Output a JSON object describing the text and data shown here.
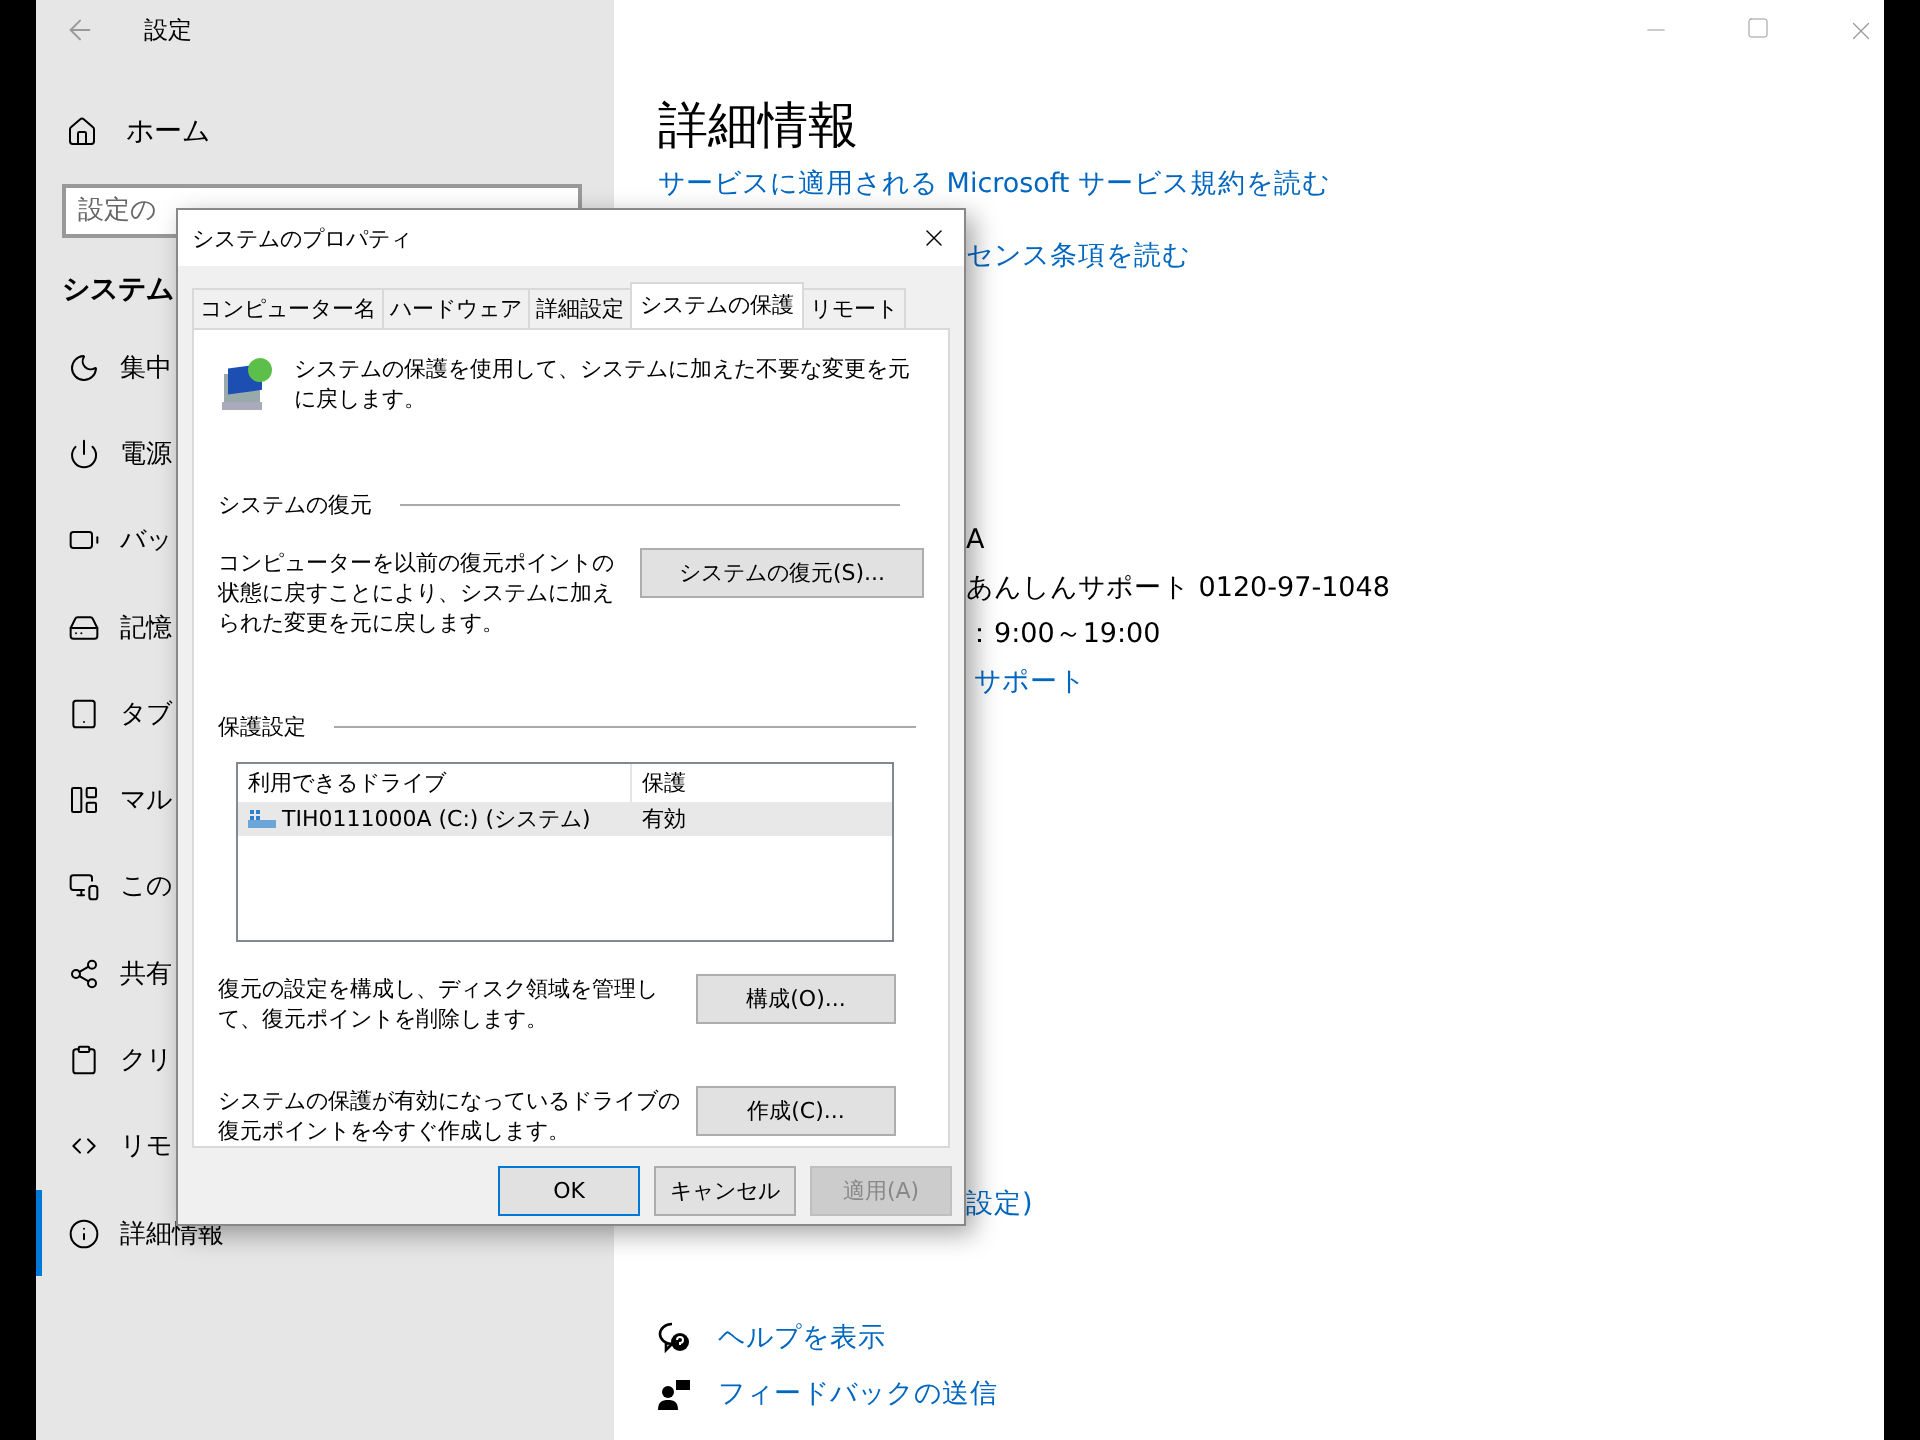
{
  "settings": {
    "title": "設定",
    "home": "ホーム",
    "search": {
      "placeholder": "設定の"
    },
    "section": "システム",
    "nav_items": [
      {
        "label": "集中",
        "selected": false
      },
      {
        "label": "電源",
        "selected": false
      },
      {
        "label": "バッ",
        "selected": false
      },
      {
        "label": "記憶",
        "selected": false
      },
      {
        "label": "タブ",
        "selected": false
      },
      {
        "label": "マル",
        "selected": false
      },
      {
        "label": "この",
        "selected": false
      },
      {
        "label": "共有",
        "selected": false
      },
      {
        "label": "クリ",
        "selected": false
      },
      {
        "label": "リモ",
        "selected": false
      },
      {
        "label": "詳細情報",
        "selected": true
      }
    ]
  },
  "main": {
    "title": "詳細情報",
    "terms_link": "サービスに適用される Microsoft サービス規約を読む",
    "license_link": "センス条項を読む",
    "support_lines": [
      {
        "kind": "text",
        "text": "A"
      },
      {
        "kind": "text",
        "text": "あんしんサポート 0120-97-1048"
      },
      {
        "kind": "text",
        "text": "：9:00～19:00"
      },
      {
        "kind": "link",
        "text": "サポート"
      }
    ],
    "settings_link": "設定)",
    "help_links": [
      "ヘルプを表示",
      "フィードバックの送信"
    ]
  },
  "dialog": {
    "title": "システムのプロパティ",
    "tabs": [
      {
        "label": "コンピューター名",
        "selected": false
      },
      {
        "label": "ハードウェア",
        "selected": false
      },
      {
        "label": "詳細設定",
        "selected": false
      },
      {
        "label": "システムの保護",
        "selected": true
      },
      {
        "label": "リモート",
        "selected": false
      }
    ],
    "intro": "システムの保護を使用して、システムに加えた不要な変更を元に戻します。",
    "restore_group": {
      "title": "システムの復元",
      "text": "コンピューターを以前の復元ポイントの状態に戻すことにより、システムに加えられた変更を元に戻します。",
      "button": "システムの復元(S)..."
    },
    "protection_group": {
      "title": "保護設定",
      "columns": [
        "利用できるドライブ",
        "保護"
      ],
      "rows": [
        {
          "drive": "TIH0111000A (C:) (システム)",
          "protection": "有効",
          "selected": true
        }
      ],
      "actions": [
        {
          "text": "復元の設定を構成し、ディスク領域を管理して、復元ポイントを削除します。",
          "button": "構成(O)..."
        },
        {
          "text": "システムの保護が有効になっているドライブの復元ポイントを今すぐ作成します。",
          "button": "作成(C)..."
        }
      ]
    },
    "buttons": [
      {
        "label": "OK",
        "default": true,
        "disabled": false
      },
      {
        "label": "キャンセル",
        "default": false,
        "disabled": false
      },
      {
        "label": "適用(A)",
        "default": false,
        "disabled": true
      }
    ]
  }
}
